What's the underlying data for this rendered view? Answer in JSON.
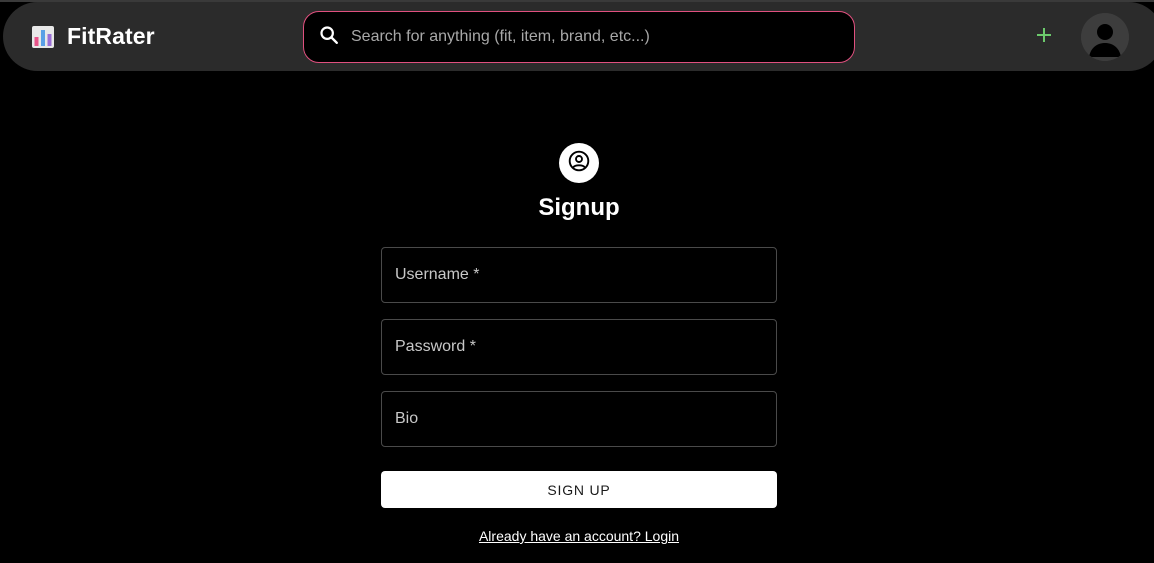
{
  "header": {
    "brand_name": "FitRater",
    "brand_icon": "bar-chart-icon",
    "search_placeholder": "Search for anything (fit, item, brand, etc...)",
    "search_value": "",
    "search_icon": "search-icon",
    "add_icon": "plus-icon",
    "avatar_icon": "user-avatar-icon"
  },
  "form": {
    "icon": "account-circle-icon",
    "title": "Signup",
    "fields": [
      {
        "key": "username",
        "placeholder": "Username *",
        "value": ""
      },
      {
        "key": "password",
        "placeholder": "Password *",
        "value": ""
      },
      {
        "key": "bio",
        "placeholder": "Bio",
        "value": ""
      }
    ],
    "submit_label": "SIGN UP",
    "login_link": "Already have an account? Login"
  },
  "colors": {
    "background": "#000000",
    "navbar": "#2b2b2b",
    "search_border": "#e0507f",
    "add_icon": "#6cc96c",
    "button_bg": "#ffffff"
  }
}
